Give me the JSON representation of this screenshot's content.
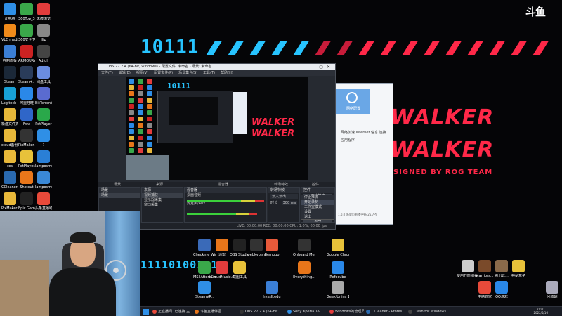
{
  "wallpaper": {
    "banner_digits": "10111",
    "logo_text": "斗鱼",
    "walker_line1": "WALKER",
    "walker_line2": "WALKER",
    "designed_by": "SIGNED BY ROG TEAM",
    "bottom_digits": "11110100101",
    "accent_blue": "#27c4ff",
    "accent_red": "#ff2848"
  },
  "desktop_left": [
    {
      "label": "此电脑",
      "icon": "computer-icon",
      "color": "#2f8fe6"
    },
    {
      "label": "360Top_3...",
      "icon": "app-icon",
      "color": "#3aa84a"
    },
    {
      "label": "无痕浏览",
      "icon": "browser-icon",
      "color": "#e23c3c"
    },
    {
      "label": "VLC media player",
      "icon": "vlc-icon",
      "color": "#f08a1a"
    },
    {
      "label": "360安全卫士",
      "icon": "shield-icon",
      "color": "#3aa84a"
    },
    {
      "label": "Ilip",
      "icon": "app-icon",
      "color": "#888"
    },
    {
      "label": "控制面板",
      "icon": "control-panel-icon",
      "color": "#3b7fd6"
    },
    {
      "label": "ARMOURY CRATE",
      "icon": "armoury-icon",
      "color": "#c22"
    },
    {
      "label": "Adfull",
      "icon": "app-icon",
      "color": "#444"
    },
    {
      "label": "Steam",
      "icon": "steam-icon",
      "color": "#1b2838"
    },
    {
      "label": "Steam+...",
      "icon": "app-icon",
      "color": "#2a3c5a"
    },
    {
      "label": "网盘工具",
      "icon": "cloud-icon",
      "color": "#6a8de0"
    },
    {
      "label": "Logitech G HUB",
      "icon": "logitech-icon",
      "color": "#18a0d6"
    },
    {
      "label": "阿里旺旺",
      "icon": "chat-icon",
      "color": "#2a88e8"
    },
    {
      "label": "BitTorrent",
      "icon": "torrent-icon",
      "color": "#5a6bd0"
    },
    {
      "label": "新建文件夹",
      "icon": "folder-icon",
      "color": "#e8b83a"
    },
    {
      "label": "Fwa",
      "icon": "app-icon",
      "color": "#2f66c8"
    },
    {
      "label": "PotPlayer",
      "icon": "player-icon",
      "color": "#2aa84a"
    },
    {
      "label": "cloud备份...",
      "icon": "folder-icon",
      "color": "#e8b83a"
    },
    {
      "label": "PixMaker...",
      "icon": "app-icon",
      "color": "#333"
    },
    {
      "label": "?",
      "icon": "help-icon",
      "color": "#2f8fe6"
    },
    {
      "label": "ccs",
      "icon": "folder-icon",
      "color": "#e8b83a"
    },
    {
      "label": "PotPlayer...",
      "icon": "player-icon",
      "color": "#e8c23a"
    },
    {
      "label": "lamposmo...",
      "icon": "app-icon",
      "color": "#2a7fd6"
    },
    {
      "label": "CCleaner...",
      "icon": "ccleaner-icon",
      "color": "#2a6ab0"
    },
    {
      "label": "Shotcut",
      "icon": "shotcut-icon",
      "color": "#e8761a"
    },
    {
      "label": "lamposmo...",
      "icon": "app-icon",
      "color": "#3a88d6"
    },
    {
      "label": "PixMaker...",
      "icon": "folder-icon",
      "color": "#e8b83a"
    },
    {
      "label": "Epic Games",
      "icon": "epic-icon",
      "color": "#222"
    },
    {
      "label": "头条直播助手",
      "icon": "app-icon",
      "color": "#e84a3a"
    }
  ],
  "desktop_bottom": [
    {
      "label": "Checkme Windows",
      "icon": "app-icon",
      "color": "#3a6ab8"
    },
    {
      "label": "迅雷",
      "icon": "thunder-icon",
      "color": "#e8761a"
    },
    {
      "label": "OBS Studio",
      "icon": "obs-icon",
      "color": "#222"
    },
    {
      "label": "webkyplay",
      "icon": "app-icon",
      "color": "#333"
    },
    {
      "label": "Bempgo",
      "icon": "app-icon",
      "color": "#e85a3a"
    },
    {
      "label": "Onboard Memory...",
      "icon": "logitech-icon",
      "color": "#333"
    },
    {
      "label": "Google Chrome",
      "icon": "chrome-icon",
      "color": "#e8c23a"
    },
    {
      "label": "MSI Afterburner",
      "icon": "afterburner-icon",
      "color": "#3aa84a"
    },
    {
      "label": "CloudMusic.exe",
      "icon": "music-icon",
      "color": "#e23c3c"
    },
    {
      "label": "截图工具",
      "icon": "screenshot-icon",
      "color": "#e8c23a"
    },
    {
      "label": "Everything...",
      "icon": "search-icon",
      "color": "#e8761a"
    },
    {
      "label": "Refocube",
      "icon": "app-icon",
      "color": "#2a88e8"
    },
    {
      "label": "SteamVR..",
      "icon": "app-icon",
      "color": "#2f8fe6"
    },
    {
      "label": "hyssIl.edu",
      "icon": "app-icon",
      "color": "#3b7fd6"
    },
    {
      "label": "GeeklUnins 1.4.8.151",
      "icon": "trash-icon",
      "color": "#aaa"
    },
    {
      "label": "使用万能图看...",
      "icon": "app-icon",
      "color": "#ccc"
    },
    {
      "label": "warriors...",
      "icon": "game-icon",
      "color": "#7a4a2a"
    },
    {
      "label": "腾讯云...",
      "icon": "app-icon",
      "color": "#8a6a4a"
    },
    {
      "label": "神秘盒子",
      "icon": "app-icon",
      "color": "#e8c23a"
    },
    {
      "label": "电脑管家",
      "icon": "app-icon",
      "color": "#e84a3a"
    },
    {
      "label": "QQ游戏",
      "icon": "qq-icon",
      "color": "#2a88e8"
    },
    {
      "label": "回收站",
      "icon": "recycle-bin-icon",
      "color": "#aab"
    }
  ],
  "obs": {
    "title": "OBS 27.2.4 (64-bit, windows) - 配置文件: 未命名 - 场景: 未命名",
    "menu": [
      "文件(F)",
      "编辑(E)",
      "视图(V)",
      "配置文件(P)",
      "场景集合(S)",
      "工具(T)",
      "帮助(H)"
    ],
    "dock_tabs": [
      "场景",
      "来源",
      "混音器",
      "转场特效",
      "控件"
    ],
    "scenes": [
      "场景"
    ],
    "sources": [
      "视频捕获",
      "显示器采集",
      "窗口采集"
    ],
    "mixer_tracks": [
      "桌面音频",
      "麦克风/Aux"
    ],
    "transition_label": "淡入淡出",
    "duration_label": "时长",
    "duration_value": "300 ms",
    "controls": [
      "开始推流",
      "开始录制",
      "启动虚拟摄像机",
      "工作室模式",
      "设置",
      "退出"
    ],
    "active_control": 1,
    "status": "LIVE: 00:00:00  REC: 00:00:00  CPU: 1.0%, 60.00 fps"
  },
  "context_menu": {
    "items": [
      "停止推流",
      "开始录制",
      "工作室模式",
      "设置",
      "退出"
    ],
    "active": 1
  },
  "app_window": {
    "sidebar_label": "网络配置",
    "line1": "网络加速  Internet 信息 连接",
    "line2": "应用程序",
    "footer": "1.0.0 (64位)  检查更新 25.7PS"
  },
  "taskbar": {
    "items": [
      {
        "label": "正直播间 [已连接 主...",
        "color": "#e84a3a"
      },
      {
        "label": "斗鱼直播伴侣",
        "color": "#e8761a"
      },
      {
        "label": "OBS 27.2.4 (64-bit...",
        "color": "#333"
      },
      {
        "label": "Sony Xperia T-v...",
        "color": "#2f8fe6"
      },
      {
        "label": "Windows的管理员...",
        "color": "#e23c3c"
      },
      {
        "label": "CCleaner - Profes...",
        "color": "#2a6ab0"
      },
      {
        "label": "Clash for Windows",
        "color": "#444"
      }
    ],
    "clock_time": "21:01",
    "clock_date": "2022/5/16"
  }
}
